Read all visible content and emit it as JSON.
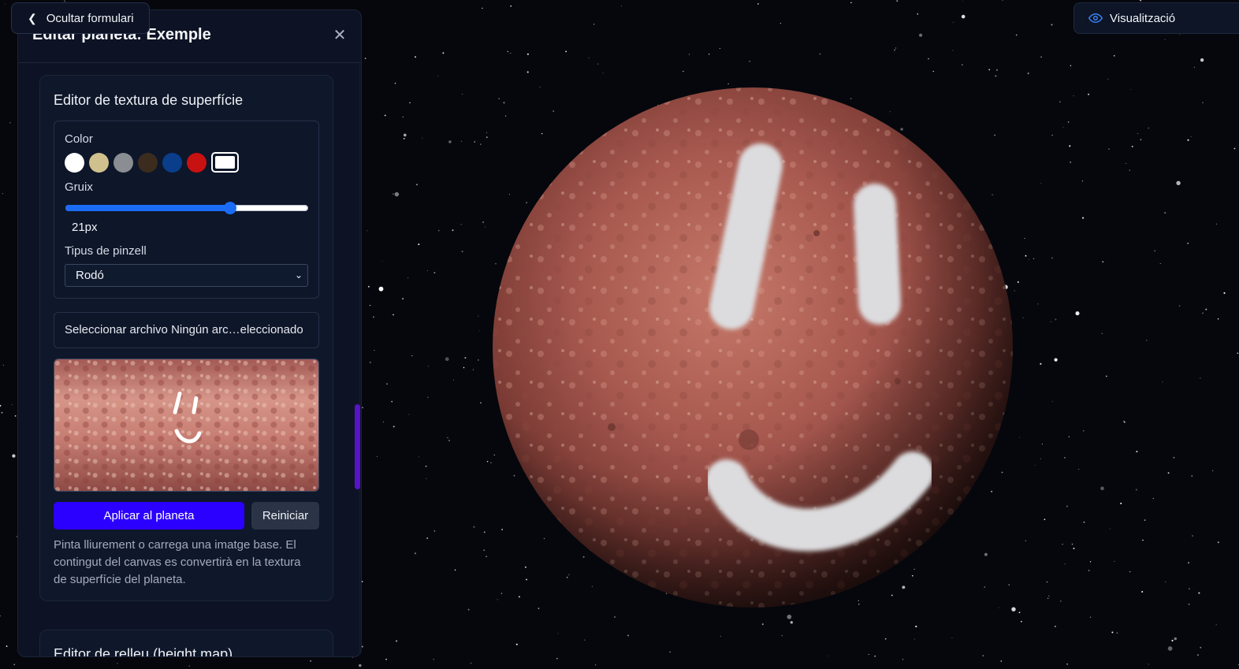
{
  "header": {
    "hide_form_label": "Ocultar formulari",
    "visualization_label": "Visualització"
  },
  "panel": {
    "title": "Editar planeta: Exemple",
    "close_icon": "close-icon",
    "texture_editor": {
      "title": "Editor de textura de superfície",
      "color_label": "Color",
      "swatches": [
        "#ffffff",
        "#cfc08d",
        "#8a8d91",
        "#3b2c1e",
        "#0a3e8a",
        "#c81111",
        "#ffffff"
      ],
      "selected_swatch_index": 6,
      "thickness_label": "Gruix",
      "thickness_value": "21px",
      "thickness_fraction": 0.68,
      "brush_type_label": "Tipus de pinzell",
      "brush_type_value": "Rodó",
      "file_input_text": "Seleccionar archivo Ningún arc…eleccionado",
      "apply_button": "Aplicar al planeta",
      "reset_button": "Reiniciar",
      "help_text": "Pinta lliurement o carrega una imatge base. El contingut del canvas es convertirà en la textura de superfície del planeta."
    },
    "height_editor": {
      "title": "Editor de relleu (height map)"
    }
  },
  "colors": {
    "accent": "#2b00ff",
    "slider": "#1a6cf5",
    "scrollbar": "#5a12c9",
    "panel_bg": "#0d1324",
    "planet": "#a8584f"
  }
}
